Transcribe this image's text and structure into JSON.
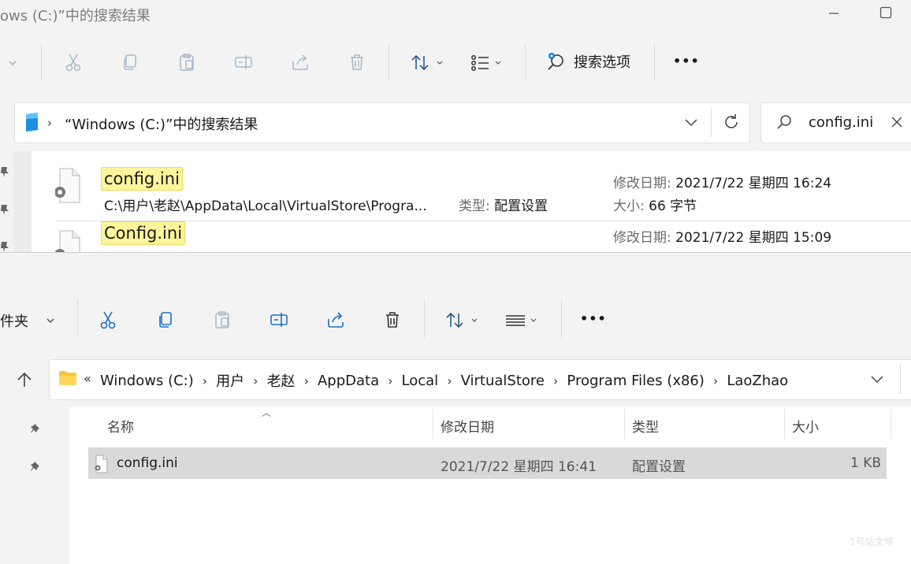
{
  "top_window": {
    "title": "ows (C:)”中的搜索结果",
    "toolbar": {
      "search_options_label": "搜索选项",
      "more_label": "•••"
    },
    "address": {
      "location": "“Windows (C:)”中的搜索结果"
    },
    "search": {
      "query": "config.ini"
    },
    "results": [
      {
        "name": "config.ini",
        "path": "C:\\用户\\老赵\\AppData\\Local\\VirtualStore\\Progra...",
        "type_label": "类型:",
        "type_value": "配置设置",
        "modified_label": "修改日期:",
        "modified_value": "2021/7/22 星期四 16:24",
        "size_label": "大小:",
        "size_value": "66 字节"
      },
      {
        "name": "Config.ini",
        "modified_label": "修改日期:",
        "modified_value": "2021/7/22 星期四 15:09"
      }
    ]
  },
  "bottom_window": {
    "toolbar": {
      "new_folder_partial": "件夹",
      "more_label": "•••"
    },
    "breadcrumb": [
      "Windows (C:)",
      "用户",
      "老赵",
      "AppData",
      "Local",
      "VirtualStore",
      "Program Files (x86)",
      "LaoZhao"
    ],
    "breadcrumb_overflow": "«",
    "columns": {
      "name": "名称",
      "modified": "修改日期",
      "type": "类型",
      "size": "大小"
    },
    "rows": [
      {
        "name": "config.ini",
        "modified": "2021/7/22 星期四 16:41",
        "type": "配置设置",
        "size": "1 KB"
      }
    ]
  },
  "watermark": "1号站文博"
}
